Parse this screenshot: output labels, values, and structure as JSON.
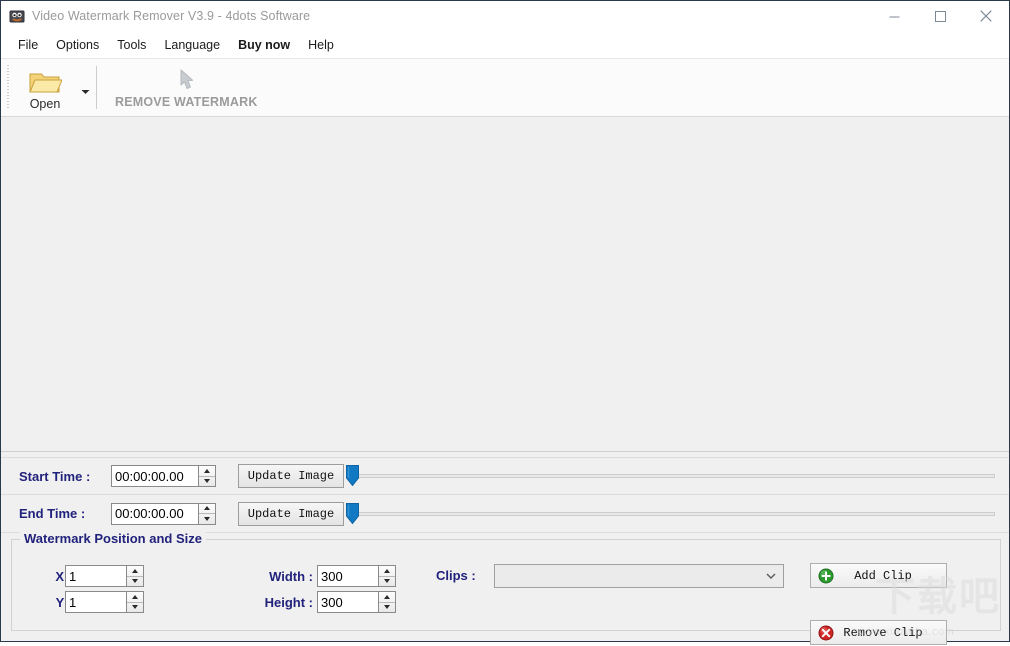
{
  "window": {
    "title": "Video Watermark Remover V3.9 - 4dots Software",
    "icon": "app-icon",
    "controls": {
      "minimize": "minimize-icon",
      "maximize": "maximize-icon",
      "close": "close-icon"
    }
  },
  "menubar": {
    "items": [
      {
        "label": "File",
        "bold": false
      },
      {
        "label": "Options",
        "bold": false
      },
      {
        "label": "Tools",
        "bold": false
      },
      {
        "label": "Language",
        "bold": false
      },
      {
        "label": "Buy now",
        "bold": true
      },
      {
        "label": "Help",
        "bold": false
      }
    ]
  },
  "toolbar": {
    "open_label": "Open",
    "open_icon": "folder-open-icon",
    "open_dropdown_icon": "chevron-down-icon",
    "remove_watermark_label": "REMOVE WATERMARK",
    "remove_watermark_icon": "cursor-arrow-icon",
    "remove_watermark_enabled": false
  },
  "timeline": {
    "start": {
      "label": "Start Time :",
      "value": "00:00:00.00",
      "update_button": "Update Image",
      "slider_position_percent": 0
    },
    "end": {
      "label": "End Time :",
      "value": "00:00:00.00",
      "update_button": "Update Image",
      "slider_position_percent": 0
    }
  },
  "watermark_group": {
    "title": "Watermark Position and Size",
    "x": {
      "label": "X :",
      "value": "1"
    },
    "y": {
      "label": "Y :",
      "value": "1"
    },
    "width": {
      "label": "Width :",
      "value": "300"
    },
    "height": {
      "label": "Height :",
      "value": "300"
    }
  },
  "clips": {
    "label": "Clips :",
    "selected": "",
    "dropdown_icon": "chevron-down-icon",
    "add_button": {
      "label": "Add Clip",
      "icon": "plus-circle-icon"
    },
    "remove_button": {
      "label": "Remove Clip",
      "icon": "x-circle-icon"
    }
  },
  "overlay_watermark": {
    "url_text": "www.xiazaiba.com",
    "logo_text": "下载吧"
  },
  "colors": {
    "label_blue": "#21227b",
    "slider_blue": "#1179c4",
    "window_bg": "#f0f0f0",
    "title_text": "#9a9a9a",
    "disabled_text": "#9b9b9b"
  }
}
